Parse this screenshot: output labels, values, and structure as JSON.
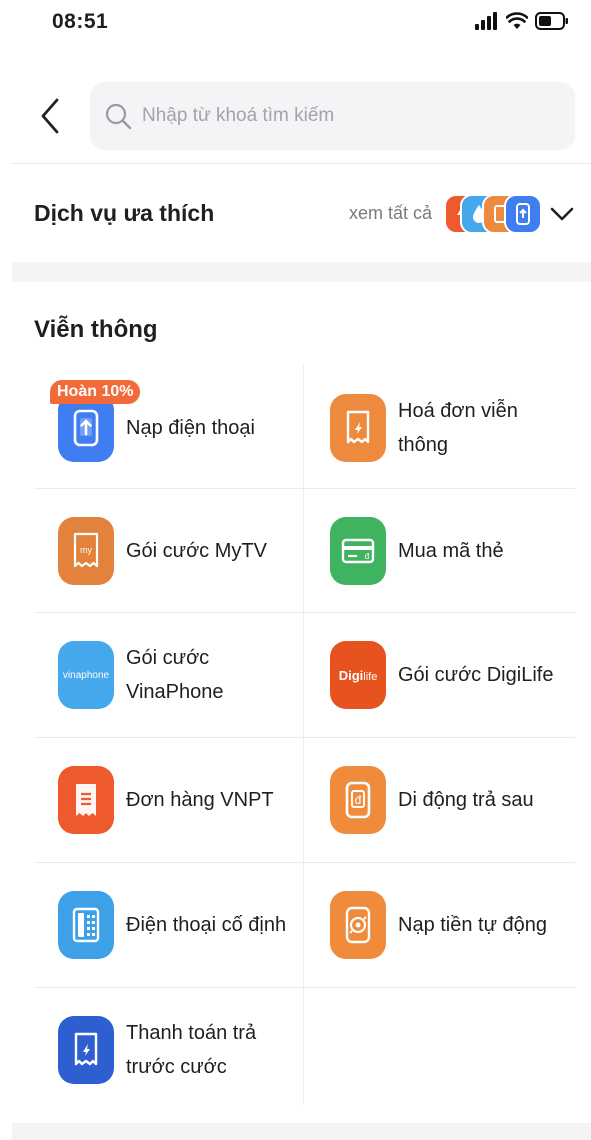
{
  "status": {
    "time": "08:51"
  },
  "search": {
    "placeholder": "Nhập từ khoá tìm kiếm"
  },
  "favorites": {
    "title": "Dịch vụ ưa thích",
    "see_all": "xem tất cả",
    "icons": [
      "flash-icon",
      "drop-icon",
      "bill-icon",
      "phone-topup-icon"
    ]
  },
  "section": {
    "title": "Viễn thông",
    "promo_badge": "Hoàn 10%",
    "items": [
      {
        "label_lines": [
          "Nạp điện thoại"
        ],
        "icon": "phone-topup-icon",
        "color": "#3f7ef0"
      },
      {
        "label_lines": [
          "Hoá đơn viễn",
          "thông"
        ],
        "icon": "telecom-bill-icon",
        "color": "#ee8a3e"
      },
      {
        "label_lines": [
          "Gói cước MyTV"
        ],
        "icon": "mytv-icon",
        "color": "#e2823c"
      },
      {
        "label_lines": [
          "Mua mã thẻ"
        ],
        "icon": "card-code-icon",
        "color": "#3fb35f"
      },
      {
        "label_lines": [
          "Gói cước",
          "VinaPhone"
        ],
        "icon": "vinaphone-icon",
        "logo_text": "vinaphone",
        "color": "#46a8ec"
      },
      {
        "label_lines": [
          "Gói cước DigiLife"
        ],
        "icon": "digilife-icon",
        "logo_text_a": "Digi",
        "logo_text_b": "life",
        "color": "#e6531f"
      },
      {
        "label_lines": [
          "Đơn hàng VNPT"
        ],
        "icon": "order-receipt-icon",
        "color": "#ee5a2e"
      },
      {
        "label_lines": [
          "Di động trả sau"
        ],
        "icon": "postpaid-icon",
        "color": "#ef8b3a"
      },
      {
        "label_lines": [
          "Điện thoại cố định"
        ],
        "icon": "landline-icon",
        "color": "#3ea0e6"
      },
      {
        "label_lines": [
          "Nạp tiền tự động"
        ],
        "icon": "auto-topup-icon",
        "color": "#ef8b3a"
      },
      {
        "label_lines": [
          "Thanh toán trả",
          "trước cước"
        ],
        "icon": "prepay-icon",
        "color": "#2d5fd0"
      }
    ]
  },
  "colors": {
    "promo": "#f26a3a",
    "text": "#1f1f1f",
    "muted": "#7a7a80",
    "band": "#f4f4f6"
  }
}
